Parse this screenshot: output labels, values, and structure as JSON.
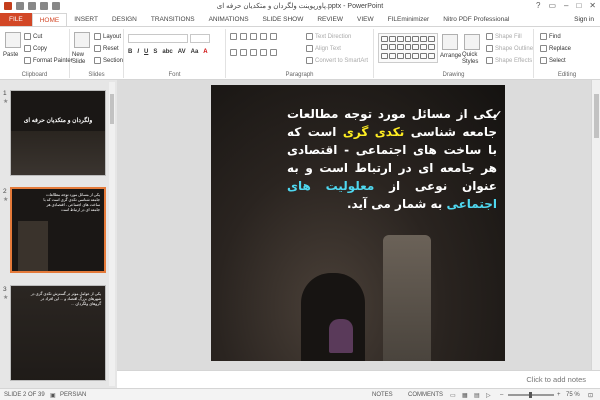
{
  "window": {
    "title": "پاورپوینت ولگردان و متکدیان حرفه ای.pptx - PowerPoint",
    "help": "?",
    "sign_in": "Sign in"
  },
  "tabs": [
    "FILE",
    "HOME",
    "INSERT",
    "DESIGN",
    "TRANSITIONS",
    "ANIMATIONS",
    "SLIDE SHOW",
    "REVIEW",
    "VIEW",
    "FILEminimizer",
    "Nitro PDF Professional"
  ],
  "active_tab": "HOME",
  "ribbon": {
    "clipboard": {
      "paste": "Paste",
      "cut": "Cut",
      "copy": "Copy",
      "format_painter": "Format Painter",
      "label": "Clipboard"
    },
    "slides": {
      "new_slide": "New Slide",
      "layout": "Layout",
      "reset": "Reset",
      "section": "Section",
      "label": "Slides"
    },
    "font": {
      "label": "Font",
      "bold": "B",
      "italic": "I",
      "underline": "U",
      "strike": "S",
      "abc": "abc",
      "av": "AV",
      "aa": "Aa",
      "font_color": "A"
    },
    "paragraph": {
      "text_direction": "Text Direction",
      "align_text": "Align Text",
      "smartart": "Convert to SmartArt",
      "label": "Paragraph"
    },
    "drawing": {
      "arrange": "Arrange",
      "quick_styles": "Quick Styles",
      "shape_fill": "Shape Fill",
      "shape_outline": "Shape Outline",
      "shape_effects": "Shape Effects",
      "label": "Drawing"
    },
    "editing": {
      "find": "Find",
      "replace": "Replace",
      "select": "Select",
      "label": "Editing"
    }
  },
  "thumbnails": [
    {
      "num": "1",
      "title": "ولگردان و متکدیان حرفه ای",
      "selected": false
    },
    {
      "num": "2",
      "text": "یکی از مسائل مورد توجه مطالعات جامعه شناسی تکدی گری است که با ساخت های اجتماعی - اقتصادی هر جامعه ای در ارتباط است",
      "selected": true
    },
    {
      "num": "3",
      "text": "یکی از عوامل موثر در گسترش تکدی گری در شهرهای بزرگ اقتصاد و ... این افراد در گروهای ولگردان ...",
      "selected": false
    }
  ],
  "slide": {
    "check": "✓",
    "line1_a": "یکی از مسائل مورد توجه مطالعات جامعه شناسی ",
    "highlight1": "تکدی گری",
    "line1_b": " است که با ساخت های اجتماعی - اقتصادی هر جامعه ای در ارتباط است و به عنوان نوعی از ",
    "highlight2": "معلولیت های اجتماعی",
    "line1_c": " به شمار می آید."
  },
  "notes_placeholder": "Click to add notes",
  "status": {
    "slide": "SLIDE 2 OF 39",
    "language": "PERSIAN",
    "notes": "NOTES",
    "comments": "COMMENTS",
    "zoom": "75 %"
  },
  "colors": {
    "accent": "#d24726",
    "highlight_yellow": "#ffee22",
    "highlight_cyan": "#4fd8f0",
    "selection_border": "#e47a3a"
  }
}
